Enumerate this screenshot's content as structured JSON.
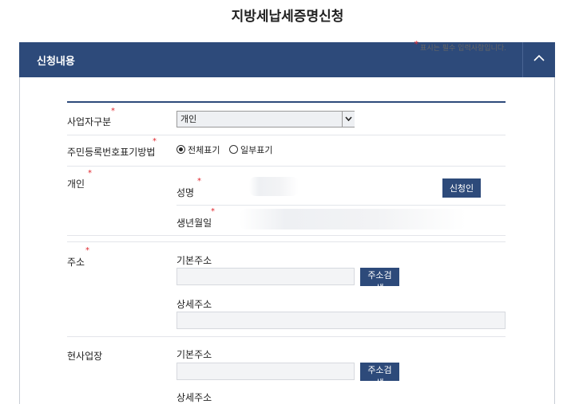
{
  "page": {
    "title": "지방세납세증명신청"
  },
  "panel": {
    "title": "신청내용",
    "required_note": "표시는 필수 입력사항입니다.",
    "required_mark": "*"
  },
  "form": {
    "business_type": {
      "label": "사업자구분",
      "selected": "개인"
    },
    "rrn_display": {
      "label": "주민등록번호표기방법",
      "options": [
        {
          "label": "전체표기",
          "checked": true
        },
        {
          "label": "일부표기",
          "checked": false
        }
      ]
    },
    "individual": {
      "label": "개인",
      "name_label": "성명",
      "applicant_button": "신청인",
      "birth_label": "생년월일"
    },
    "address": {
      "label": "주소",
      "basic_label": "기본주소",
      "search_button": "주소검색",
      "detail_label": "상세주소"
    },
    "business_site": {
      "label": "현사업장",
      "basic_label": "기본주소",
      "search_button": "주소검색",
      "detail_label": "상세주소"
    }
  },
  "colors": {
    "navy": "#2d4a7a",
    "required": "#e0262d"
  }
}
